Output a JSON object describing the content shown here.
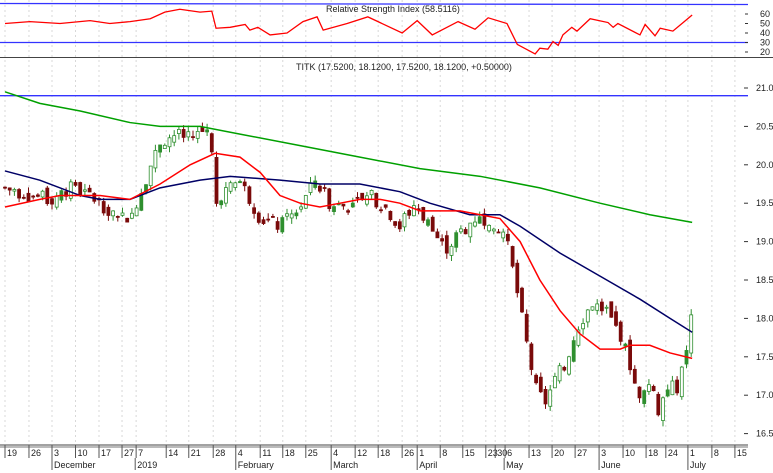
{
  "chart_data": {
    "type": "candlestick",
    "rsi_panel": {
      "title": "Relative Strength Index (58.5116)",
      "yticks": [
        60,
        50,
        40,
        30,
        20
      ],
      "ylim": [
        15,
        70
      ],
      "bands": [
        70,
        30
      ],
      "series": [
        [
          0,
          50
        ],
        [
          5.3,
          52
        ],
        [
          11.7,
          50
        ],
        [
          18.1,
          53
        ],
        [
          22.3,
          50
        ],
        [
          26.6,
          52
        ],
        [
          30.9,
          55
        ],
        [
          34,
          62
        ],
        [
          37.2,
          65
        ],
        [
          41.5,
          62
        ],
        [
          44,
          63
        ],
        [
          44.9,
          45
        ],
        [
          47.9,
          46
        ],
        [
          51.1,
          49
        ],
        [
          52.1,
          43
        ],
        [
          53.8,
          46
        ],
        [
          56.4,
          38
        ],
        [
          60,
          40
        ],
        [
          63.4,
          52
        ],
        [
          66.4,
          57
        ],
        [
          67.7,
          43
        ],
        [
          72.8,
          50
        ],
        [
          77.2,
          57
        ],
        [
          84.5,
          40
        ],
        [
          87.7,
          53
        ],
        [
          90.9,
          38
        ],
        [
          96.4,
          52
        ],
        [
          100,
          44
        ],
        [
          102.8,
          56
        ],
        [
          106.8,
          50
        ],
        [
          109,
          28
        ],
        [
          112.8,
          18
        ],
        [
          113.8,
          24
        ],
        [
          115.5,
          23
        ],
        [
          116.6,
          31
        ],
        [
          117.7,
          27
        ],
        [
          118.7,
          38
        ],
        [
          120.6,
          46
        ],
        [
          121.7,
          42
        ],
        [
          124.5,
          55
        ],
        [
          128.3,
          51
        ],
        [
          129.4,
          46
        ],
        [
          130.4,
          50
        ],
        [
          135.1,
          38
        ],
        [
          136.2,
          49
        ],
        [
          138.3,
          37
        ],
        [
          139.4,
          45
        ],
        [
          142.1,
          42
        ],
        [
          144.3,
          51
        ],
        [
          146.2,
          59
        ]
      ]
    },
    "price_panel": {
      "title": "TITK (17.5200, 18.1200, 17.5200, 18.1200, +0.50000)",
      "yticks": [
        "21.0",
        "20.5",
        "20.0",
        "19.5",
        "19.0",
        "18.5",
        "18.0",
        "17.5",
        "17.0",
        "16.5"
      ],
      "ylim": [
        16.3,
        21.4
      ],
      "hline": 20.9,
      "price_path": [
        [
          0,
          19.7
        ],
        [
          5.3,
          19.6
        ],
        [
          9.6,
          19.55
        ],
        [
          13.8,
          19.7
        ],
        [
          18.1,
          19.6
        ],
        [
          22.3,
          19.4
        ],
        [
          26.6,
          19.3
        ],
        [
          29.8,
          19.8
        ],
        [
          33,
          20.3
        ],
        [
          36.2,
          20.4
        ],
        [
          39.4,
          20.35
        ],
        [
          43.6,
          20.5
        ],
        [
          44.7,
          19.5
        ],
        [
          45.7,
          19.6
        ],
        [
          50,
          19.8
        ],
        [
          54.3,
          19.3
        ],
        [
          58.5,
          19.2
        ],
        [
          62.8,
          19.45
        ],
        [
          66,
          19.8
        ],
        [
          69.1,
          19.5
        ],
        [
          73.4,
          19.45
        ],
        [
          77.7,
          19.6
        ],
        [
          80.9,
          19.45
        ],
        [
          84,
          19.2
        ],
        [
          87.2,
          19.5
        ],
        [
          90.4,
          19.2
        ],
        [
          93.6,
          18.9
        ],
        [
          96.8,
          19.1
        ],
        [
          100,
          19.3
        ],
        [
          103.2,
          19.3
        ],
        [
          106.4,
          19.1
        ],
        [
          108.5,
          18.5
        ],
        [
          110.6,
          17.8
        ],
        [
          112.8,
          17.1
        ],
        [
          114.9,
          16.9
        ],
        [
          117,
          17.2
        ],
        [
          119.1,
          17.4
        ],
        [
          121.9,
          17.9
        ],
        [
          124.9,
          18.2
        ],
        [
          127.7,
          18.1
        ],
        [
          130.9,
          17.8
        ],
        [
          133,
          17.4
        ],
        [
          135.1,
          16.9
        ],
        [
          137.2,
          17.2
        ],
        [
          138.9,
          16.8
        ],
        [
          141.1,
          17.1
        ],
        [
          143.2,
          17.1
        ],
        [
          145.3,
          17.6
        ],
        [
          146.2,
          18.12
        ]
      ],
      "ma_short": [
        [
          0,
          19.45
        ],
        [
          7.4,
          19.55
        ],
        [
          11.7,
          19.6
        ],
        [
          20.2,
          19.6
        ],
        [
          26.6,
          19.55
        ],
        [
          33,
          19.75
        ],
        [
          39.4,
          20.0
        ],
        [
          44.7,
          20.15
        ],
        [
          50,
          20.1
        ],
        [
          54.3,
          19.9
        ],
        [
          58.5,
          19.6
        ],
        [
          62.8,
          19.5
        ],
        [
          67,
          19.45
        ],
        [
          71.3,
          19.5
        ],
        [
          75.5,
          19.55
        ],
        [
          79.8,
          19.55
        ],
        [
          84,
          19.5
        ],
        [
          88.3,
          19.4
        ],
        [
          96.8,
          19.4
        ],
        [
          101.1,
          19.35
        ],
        [
          105.3,
          19.3
        ],
        [
          109.6,
          19.0
        ],
        [
          113.8,
          18.5
        ],
        [
          118.1,
          18.1
        ],
        [
          122.3,
          17.8
        ],
        [
          126.6,
          17.6
        ],
        [
          130.9,
          17.6
        ],
        [
          133,
          17.65
        ],
        [
          137.2,
          17.65
        ],
        [
          141.5,
          17.55
        ],
        [
          146.2,
          17.48
        ]
      ],
      "ma_mid": [
        [
          0,
          19.92
        ],
        [
          7.4,
          19.8
        ],
        [
          16,
          19.6
        ],
        [
          20.2,
          19.55
        ],
        [
          26.6,
          19.55
        ],
        [
          33,
          19.7
        ],
        [
          41.5,
          19.8
        ],
        [
          47.9,
          19.85
        ],
        [
          58.5,
          19.8
        ],
        [
          67,
          19.75
        ],
        [
          75.5,
          19.75
        ],
        [
          84,
          19.65
        ],
        [
          90.4,
          19.5
        ],
        [
          98.9,
          19.35
        ],
        [
          105.3,
          19.35
        ],
        [
          109.6,
          19.2
        ],
        [
          118.1,
          18.85
        ],
        [
          126.6,
          18.55
        ],
        [
          135.1,
          18.25
        ],
        [
          141.5,
          18.0
        ],
        [
          146.2,
          17.82
        ]
      ],
      "ma_long": [
        [
          0,
          20.95
        ],
        [
          7.4,
          20.8
        ],
        [
          16,
          20.7
        ],
        [
          26.6,
          20.55
        ],
        [
          33,
          20.5
        ],
        [
          41.5,
          20.5
        ],
        [
          50,
          20.4
        ],
        [
          62.8,
          20.25
        ],
        [
          75.5,
          20.1
        ],
        [
          88.3,
          19.95
        ],
        [
          101.1,
          19.85
        ],
        [
          113.8,
          19.7
        ],
        [
          126.6,
          19.5
        ],
        [
          137.2,
          19.35
        ],
        [
          146.2,
          19.25
        ]
      ]
    },
    "x_axis": {
      "xlim": [
        0,
        158
      ],
      "day_ticks": [
        [
          0,
          "19"
        ],
        [
          5.1,
          "26"
        ],
        [
          10,
          "3"
        ],
        [
          15,
          "10"
        ],
        [
          20,
          "17"
        ],
        [
          24.9,
          "27"
        ],
        [
          27.9,
          "7"
        ],
        [
          34.3,
          "14"
        ],
        [
          39.1,
          "21"
        ],
        [
          44.3,
          "28"
        ],
        [
          49.1,
          "4"
        ],
        [
          54.3,
          "11"
        ],
        [
          59.1,
          "18"
        ],
        [
          64,
          "25"
        ],
        [
          69.4,
          "4"
        ],
        [
          74.5,
          "12"
        ],
        [
          79.4,
          "18"
        ],
        [
          84.5,
          "26"
        ],
        [
          87.7,
          "1"
        ],
        [
          92.6,
          "8"
        ],
        [
          97.4,
          "15"
        ],
        [
          102.3,
          "23"
        ],
        [
          104.3,
          "30"
        ],
        [
          106.4,
          "6"
        ],
        [
          111.5,
          "13"
        ],
        [
          116.4,
          "20"
        ],
        [
          121.3,
          "27"
        ],
        [
          126.4,
          "3"
        ],
        [
          131.5,
          "10"
        ],
        [
          136.4,
          "18"
        ],
        [
          140.6,
          "24"
        ],
        [
          145.3,
          "1"
        ],
        [
          150.4,
          "8"
        ],
        [
          155.3,
          "15"
        ]
      ],
      "month_ticks": [
        [
          10,
          "December"
        ],
        [
          27.7,
          "2019"
        ],
        [
          49.1,
          "February"
        ],
        [
          69.4,
          "March"
        ],
        [
          87.7,
          "April"
        ],
        [
          106.2,
          "May"
        ],
        [
          126.4,
          "June"
        ],
        [
          145.3,
          "July"
        ]
      ]
    },
    "colors": {
      "up": "#2f8f2f",
      "down": "#7a0a0a",
      "ma_short": "#ff0000",
      "ma_mid": "#000066",
      "ma_long": "#00a000",
      "rsi": "#ff0000",
      "band": "#3333ff"
    }
  }
}
